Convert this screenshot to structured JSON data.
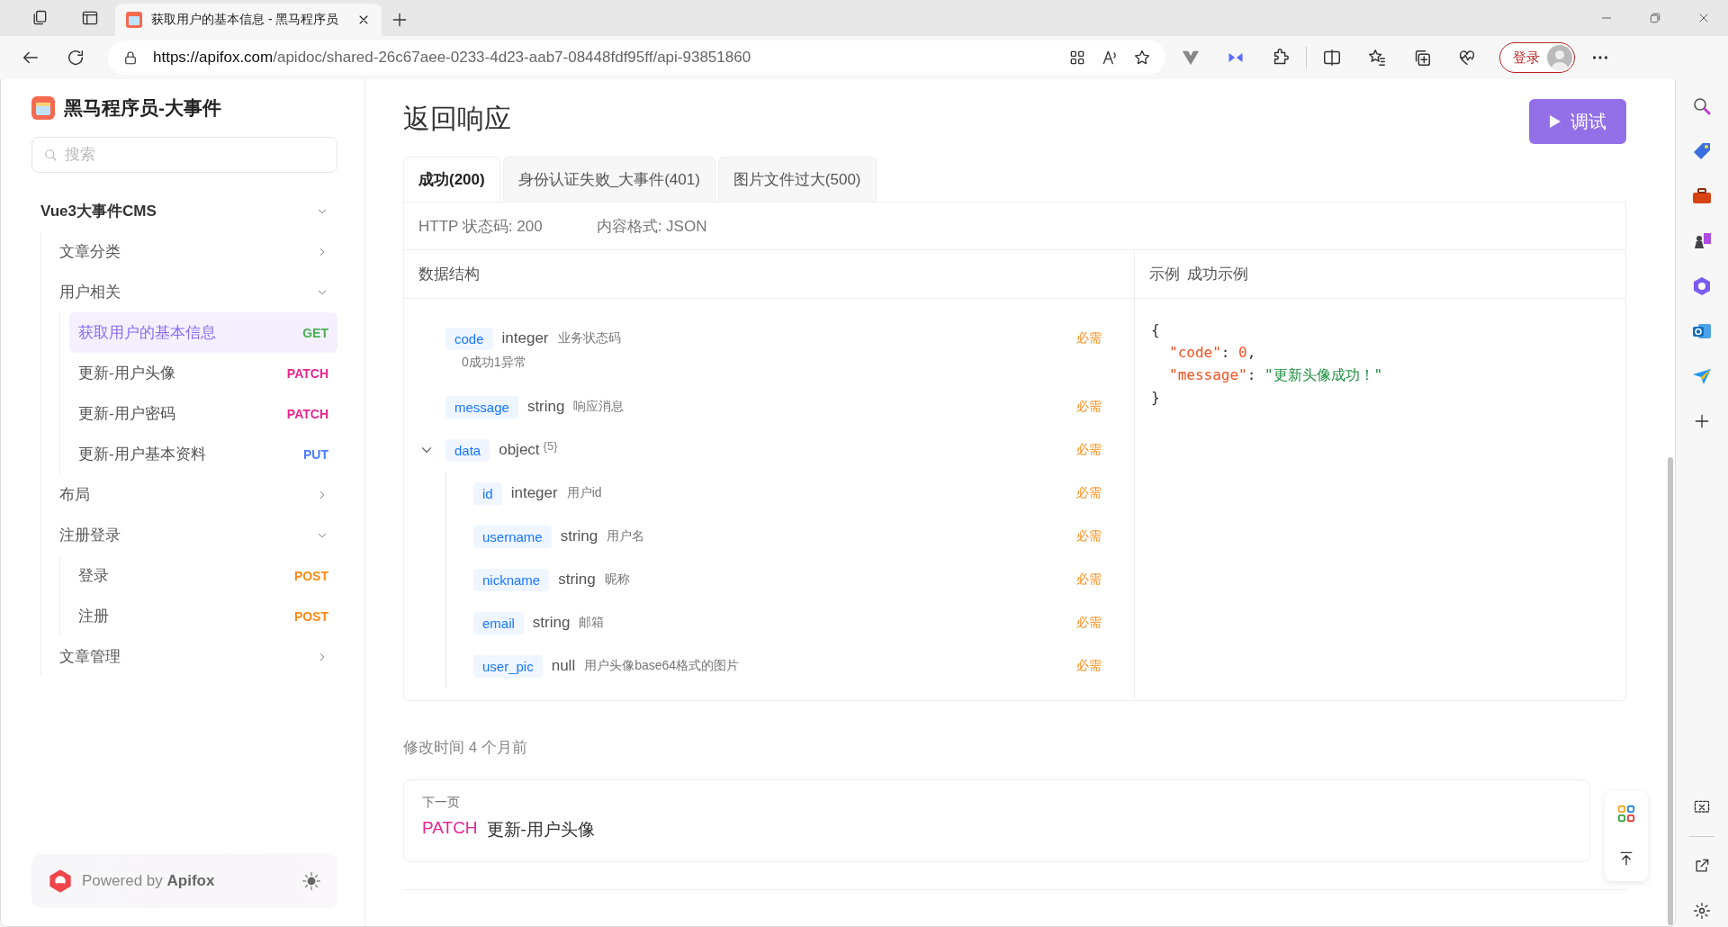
{
  "browser": {
    "tab_title": "获取用户的基本信息 - 黑马程序员",
    "url_host": "https://apifox.com",
    "url_path": "/apidoc/shared-26c67aee-0233-4d23-aab7-08448fdf95ff/api-93851860",
    "login_button": "登录"
  },
  "sidebar": {
    "project_title": "黑马程序员-大事件",
    "search": {
      "placeholder": "搜索"
    },
    "tree": [
      {
        "kind": "folder",
        "label": "Vue3大事件CMS",
        "expanded": true,
        "children": [
          {
            "kind": "folder",
            "label": "文章分类",
            "expanded": false
          },
          {
            "kind": "folder",
            "label": "用户相关",
            "expanded": true,
            "children": [
              {
                "kind": "endpoint",
                "label": "获取用户的基本信息",
                "method": "GET",
                "color": "#4caf50",
                "selected": true
              },
              {
                "kind": "endpoint",
                "label": "更新-用户头像",
                "method": "PATCH",
                "color": "#e5268f",
                "selected": false
              },
              {
                "kind": "endpoint",
                "label": "更新-用户密码",
                "method": "PATCH",
                "color": "#e5268f",
                "selected": false
              },
              {
                "kind": "endpoint",
                "label": "更新-用户基本资料",
                "method": "PUT",
                "color": "#4a7dff",
                "selected": false
              }
            ]
          },
          {
            "kind": "folder",
            "label": "布局",
            "expanded": false
          },
          {
            "kind": "folder",
            "label": "注册登录",
            "expanded": true,
            "children": [
              {
                "kind": "endpoint",
                "label": "登录",
                "method": "POST",
                "color": "#fa8c16",
                "selected": false
              },
              {
                "kind": "endpoint",
                "label": "注册",
                "method": "POST",
                "color": "#fa8c16",
                "selected": false
              }
            ]
          },
          {
            "kind": "folder",
            "label": "文章管理",
            "expanded": false
          }
        ]
      }
    ],
    "footer": "Powered by **Apifox**"
  },
  "main": {
    "heading": "返回响应",
    "debug_button": "调试",
    "tabs": [
      {
        "label": "成功(200)",
        "selected": true
      },
      {
        "label": "身份认证失败_大事件(401)",
        "selected": false
      },
      {
        "label": "图片文件过大(500)",
        "selected": false
      }
    ],
    "status_code": "HTTP 状态码: 200",
    "content_type": "内容格式: JSON",
    "schema_title": "数据结构",
    "fields": [
      {
        "name": "code",
        "type": "integer",
        "description": "业务状态码",
        "required": "必需",
        "note": "0成功1异常"
      },
      {
        "name": "message",
        "type": "string",
        "description": "响应消息",
        "required": "必需"
      },
      {
        "name": "data",
        "type": "object",
        "count": "{5}",
        "required": "必需",
        "expanded": true,
        "children": [
          {
            "name": "id",
            "type": "integer",
            "description": "用户id",
            "required": "必需"
          },
          {
            "name": "username",
            "type": "string",
            "description": "用户名",
            "required": "必需"
          },
          {
            "name": "nickname",
            "type": "string",
            "description": "昵称",
            "required": "必需"
          },
          {
            "name": "email",
            "type": "string",
            "description": "邮箱",
            "required": "必需"
          },
          {
            "name": "user_pic",
            "type": "null",
            "description": "用户头像base64格式的图片",
            "required": "必需"
          }
        ]
      }
    ],
    "example_label": "示例",
    "example_name": "成功示例",
    "example_lines": [
      {
        "kind": "brace",
        "text": "{"
      },
      {
        "kind": "number_entry",
        "key": "\"code\"",
        "colon": ": ",
        "value": "0",
        "tail": ","
      },
      {
        "kind": "string_entry",
        "key": "\"message\"",
        "colon": ": ",
        "value": "\"更新头像成功！\""
      },
      {
        "kind": "brace",
        "text": "}"
      }
    ],
    "modified": "修改时间 4 个月前",
    "next_page": {
      "label": "下一页",
      "method": "PATCH",
      "color": "#e5268f",
      "title": "更新-用户头像"
    }
  }
}
